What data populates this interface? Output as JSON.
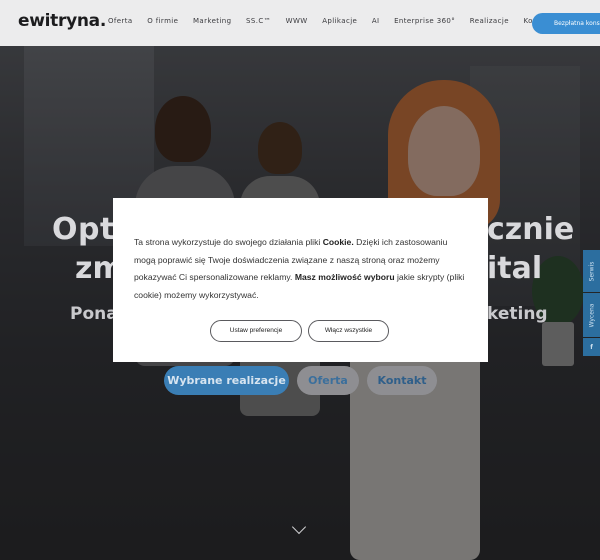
{
  "header": {
    "logo": "ewitryna.",
    "nav": [
      "Oferta",
      "O firmie",
      "Marketing",
      "SS.C™",
      "WWW",
      "Aplikacje",
      "AI",
      "Enterprise 360°",
      "Realizacje",
      "Kontakt"
    ],
    "cta_label": "Bezpłatna konsultacja",
    "accent_color": "#3a8ed3"
  },
  "hero": {
    "title_line1_left": "Opty",
    "title_line1_right": "cznie",
    "title_line2_left": "zm",
    "title_line2_right": "ital",
    "subtitle_left": "Ponac",
    "subtitle_right": "keting",
    "buttons": {
      "primary": "Wybrane realizacje",
      "offer": "Oferta",
      "contact": "Kontakt"
    },
    "scroll_icon": "chevron-down-icon"
  },
  "side_tabs": {
    "serwis": "Serwis",
    "wycena": "Wycena",
    "facebook": "f"
  },
  "cookie_modal": {
    "text_part1": "Ta strona wykorzystuje do swojego działania pliki ",
    "text_bold1": "Cookie.",
    "text_part2": " Dzięki ich zastosowaniu mogą poprawić się Twoje doświadczenia związane z naszą stroną oraz możemy pokazywać Ci spersonalizowane reklamy. ",
    "text_bold2": "Masz możliwość wyboru",
    "text_part3": " jakie skrypty (pliki cookie) możemy wykorzystywać.",
    "preferences_button": "Ustaw preferencje",
    "accept_all_button": "Włącz wszystkie"
  }
}
